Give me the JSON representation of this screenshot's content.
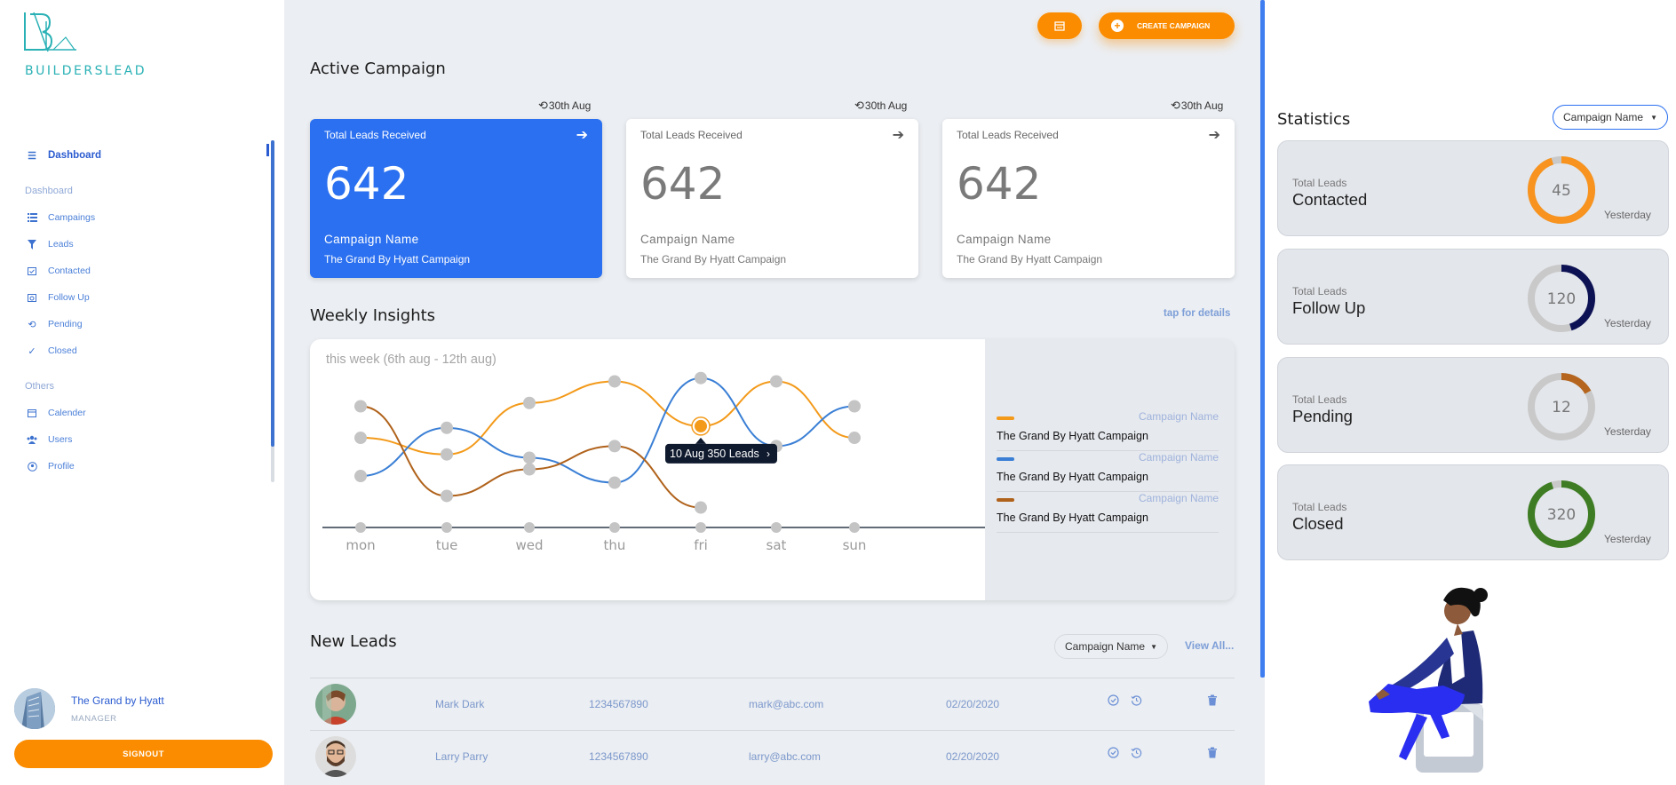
{
  "brand": {
    "name": "BUILDERSLEAD"
  },
  "sidebar": {
    "active": "Dashboard",
    "section_dashboard": "Dashboard",
    "items": [
      {
        "label": "Campaings",
        "icon": "list-icon"
      },
      {
        "label": "Leads",
        "icon": "filter-icon"
      },
      {
        "label": "Contacted",
        "icon": "calendar-check-icon"
      },
      {
        "label": "Follow Up",
        "icon": "calendar-clock-icon"
      },
      {
        "label": "Pending",
        "icon": "history-icon"
      },
      {
        "label": "Closed",
        "icon": "double-check-icon"
      }
    ],
    "section_others": "Others",
    "others": [
      {
        "label": "Calender",
        "icon": "calendar-icon"
      },
      {
        "label": "Users",
        "icon": "users-icon"
      },
      {
        "label": "Profile",
        "icon": "profile-icon"
      }
    ],
    "user": {
      "name": "The Grand by Hyatt",
      "role": "MANAGER"
    },
    "signout": "SIGNOUT"
  },
  "toolbar": {
    "create_label": "CREATE CAMPAIGN"
  },
  "active_campaign": {
    "title": "Active Campaign",
    "cards": [
      {
        "date": "30th Aug",
        "title": "Total Leads Received",
        "count": "642",
        "name_label": "Campaign Name",
        "name": "The Grand By Hyatt Campaign"
      },
      {
        "date": "30th Aug",
        "title": "Total Leads Received",
        "count": "642",
        "name_label": "Campaign Name",
        "name": "The Grand By Hyatt Campaign"
      },
      {
        "date": "30th Aug",
        "title": "Total Leads Received",
        "count": "642",
        "name_label": "Campaign Name",
        "name": "The Grand By Hyatt Campaign"
      }
    ]
  },
  "insights": {
    "title": "Weekly Insights",
    "link": "tap for details",
    "week": "this week (6th aug - 12th aug)",
    "tooltip": "10 Aug 350 Leads",
    "legend": [
      {
        "name": "Campaign Name",
        "sub": "The Grand By Hyatt Campaign",
        "color": "#f39a1a"
      },
      {
        "name": "Campaign Name",
        "sub": "The Grand By Hyatt Campaign",
        "color": "#3a7fd5"
      },
      {
        "name": "Campaign Name",
        "sub": "The Grand By Hyatt Campaign",
        "color": "#b0621b"
      }
    ]
  },
  "chart_data": {
    "type": "line",
    "categories": [
      "mon",
      "tue",
      "wed",
      "thu",
      "fri",
      "sat",
      "sun"
    ],
    "ylim": [
      0,
      100
    ],
    "grid": false,
    "series": [
      {
        "color": "#f39a1a",
        "values": [
          54,
          44,
          75,
          88,
          61,
          88,
          54
        ],
        "partial": false
      },
      {
        "color": "#3a7fd5",
        "values": [
          31,
          60,
          42,
          27,
          90,
          49,
          73
        ],
        "partial": false
      },
      {
        "color": "#b0621b",
        "values": [
          73,
          19,
          35,
          49,
          12
        ],
        "partial": true
      }
    ],
    "highlight": {
      "series": 0,
      "index": 4
    }
  },
  "new_leads": {
    "title": "New Leads",
    "filter": "Campaign Name",
    "view_all": "View All...",
    "rows": [
      {
        "name": "Mark Dark",
        "phone": "1234567890",
        "email": "mark@abc.com",
        "date": "02/20/2020"
      },
      {
        "name": "Larry Parry",
        "phone": "1234567890",
        "email": "larry@abc.com",
        "date": "02/20/2020"
      }
    ]
  },
  "statistics": {
    "title": "Statistics",
    "filter": "Campaign Name",
    "cards": [
      {
        "small": "Total Leads",
        "big": "Contacted",
        "value": "45",
        "fraction": 0.95,
        "color": "#f7931e",
        "when": "Yesterday"
      },
      {
        "small": "Total Leads",
        "big": "Follow Up",
        "value": "120",
        "fraction": 0.45,
        "color": "#0d1254",
        "when": "Yesterday"
      },
      {
        "small": "Total Leads",
        "big": "Pending",
        "value": "12",
        "fraction": 0.17,
        "color": "#b5651d",
        "when": "Yesterday"
      },
      {
        "small": "Total Leads",
        "big": "Closed",
        "value": "320",
        "fraction": 0.95,
        "color": "#3f7d24",
        "when": "Yesterday"
      }
    ]
  }
}
